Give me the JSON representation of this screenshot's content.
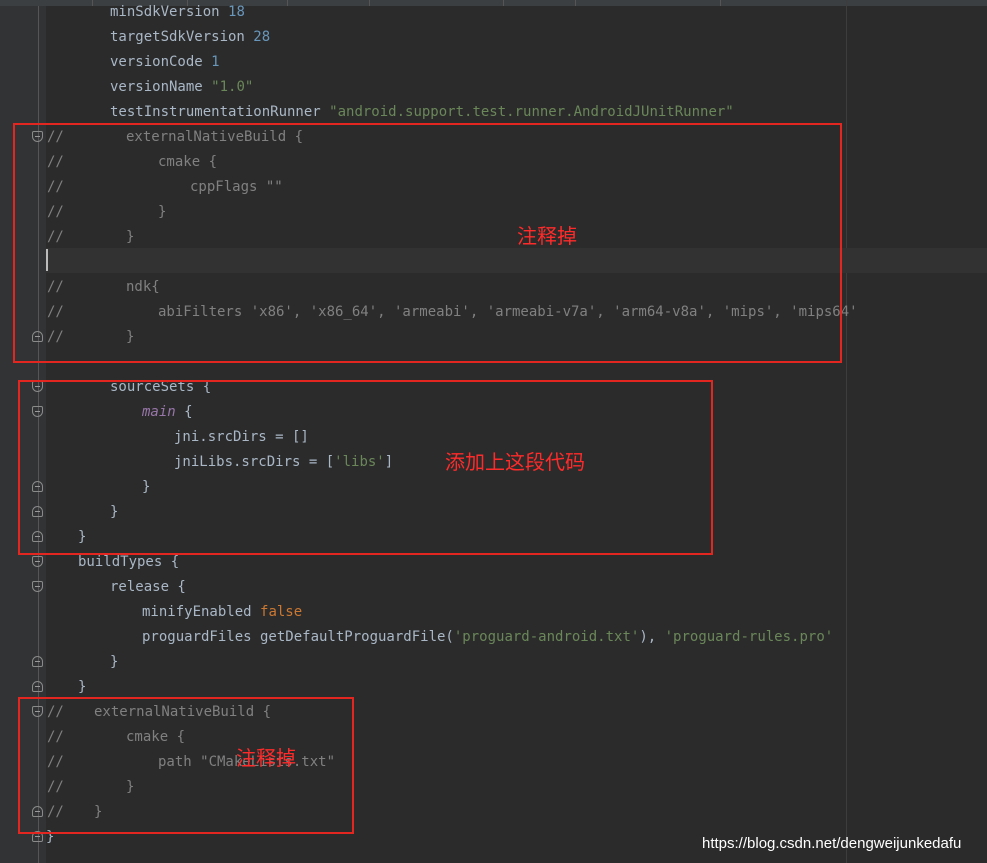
{
  "editor": {
    "lines": [
      {
        "id": "min-sdk",
        "segments": [
          {
            "t": "minSdkVersion ",
            "c": ""
          },
          {
            "t": "18",
            "c": "num"
          }
        ]
      },
      {
        "id": "target-sdk",
        "segments": [
          {
            "t": "targetSdkVersion ",
            "c": ""
          },
          {
            "t": "28",
            "c": "num"
          }
        ]
      },
      {
        "id": "version-code",
        "segments": [
          {
            "t": "versionCode ",
            "c": ""
          },
          {
            "t": "1",
            "c": "num"
          }
        ]
      },
      {
        "id": "version-name",
        "segments": [
          {
            "t": "versionName ",
            "c": ""
          },
          {
            "t": "\"1.0\"",
            "c": "str"
          }
        ]
      },
      {
        "id": "test-runner",
        "segments": [
          {
            "t": "testInstrumentationRunner ",
            "c": ""
          },
          {
            "t": "\"android.support.test.runner.AndroidJUnitRunner\"",
            "c": "str"
          }
        ]
      },
      {
        "id": "ext-native-build-1",
        "segments": [
          {
            "t": "externalNativeBuild {",
            "c": "cm"
          }
        ]
      },
      {
        "id": "cmake-1",
        "segments": [
          {
            "t": "cmake {",
            "c": "cm"
          }
        ]
      },
      {
        "id": "cpp-flags",
        "segments": [
          {
            "t": "cppFlags \"\"",
            "c": "cm"
          }
        ]
      },
      {
        "id": "close-1",
        "segments": [
          {
            "t": "}",
            "c": "cm"
          }
        ]
      },
      {
        "id": "close-2",
        "segments": [
          {
            "t": "}",
            "c": "cm"
          }
        ]
      },
      {
        "id": "blank",
        "segments": []
      },
      {
        "id": "ndk",
        "segments": [
          {
            "t": "ndk{",
            "c": "cm"
          }
        ]
      },
      {
        "id": "abi-filters",
        "segments": [
          {
            "t": "abiFilters 'x86', 'x86_64', 'armeabi', 'armeabi-v7a', 'arm64-v8a', 'mips', 'mips64'",
            "c": "cm"
          }
        ]
      },
      {
        "id": "close-3",
        "segments": [
          {
            "t": "}",
            "c": "cm"
          }
        ]
      },
      {
        "id": "empty",
        "segments": []
      },
      {
        "id": "source-sets",
        "segments": [
          {
            "t": "sourceSets {",
            "c": ""
          }
        ]
      },
      {
        "id": "main",
        "segments": [
          {
            "t": "main",
            "c": "ital"
          },
          {
            "t": " {",
            "c": ""
          }
        ]
      },
      {
        "id": "jni-src",
        "segments": [
          {
            "t": "jni.srcDirs = []",
            "c": ""
          }
        ]
      },
      {
        "id": "jni-libs",
        "segments": [
          {
            "t": "jniLibs.srcDirs = [",
            "c": ""
          },
          {
            "t": "'libs'",
            "c": "str"
          },
          {
            "t": "]",
            "c": ""
          }
        ]
      },
      {
        "id": "close-main",
        "segments": [
          {
            "t": "}",
            "c": ""
          }
        ]
      },
      {
        "id": "close-source-sets",
        "segments": [
          {
            "t": "}",
            "c": ""
          }
        ]
      },
      {
        "id": "close-default-config",
        "segments": [
          {
            "t": "}",
            "c": ""
          }
        ]
      },
      {
        "id": "build-types",
        "segments": [
          {
            "t": "buildTypes {",
            "c": ""
          }
        ]
      },
      {
        "id": "release",
        "segments": [
          {
            "t": "release {",
            "c": ""
          }
        ]
      },
      {
        "id": "minify",
        "segments": [
          {
            "t": "minifyEnabled ",
            "c": ""
          },
          {
            "t": "false",
            "c": "kw"
          }
        ]
      },
      {
        "id": "proguard",
        "segments": [
          {
            "t": "proguardFiles getDefaultProguardFile(",
            "c": ""
          },
          {
            "t": "'proguard-android.txt'",
            "c": "str"
          },
          {
            "t": "), ",
            "c": ""
          },
          {
            "t": "'proguard-rules.pro'",
            "c": "str"
          }
        ]
      },
      {
        "id": "close-release",
        "segments": [
          {
            "t": "}",
            "c": ""
          }
        ]
      },
      {
        "id": "close-build-types",
        "segments": [
          {
            "t": "}",
            "c": ""
          }
        ]
      },
      {
        "id": "ext-native-build-2",
        "segments": [
          {
            "t": "externalNativeBuild {",
            "c": "cm"
          }
        ]
      },
      {
        "id": "cmake-2",
        "segments": [
          {
            "t": "cmake {",
            "c": "cm"
          }
        ]
      },
      {
        "id": "cmake-path",
        "segments": [
          {
            "t": "path \"CMakeLists.txt\"",
            "c": "cm"
          }
        ]
      },
      {
        "id": "close-4",
        "segments": [
          {
            "t": "}",
            "c": "cm"
          }
        ]
      },
      {
        "id": "close-5",
        "segments": [
          {
            "t": "}",
            "c": "cm"
          }
        ]
      },
      {
        "id": "close-android",
        "segments": [
          {
            "t": "}",
            "c": ""
          }
        ]
      }
    ],
    "comment_marker": "//"
  },
  "annotations": {
    "comment_out_1": "注释掉",
    "add_code": "添加上这段代码",
    "comment_out_2": "注释掉"
  },
  "watermark": "https://blog.csdn.net/dengweijunkedafu",
  "colors": {
    "background": "#2b2b2b",
    "annotation_red": "#e3261f",
    "string": "#6a8759",
    "number": "#6897bb",
    "keyword": "#cc7832",
    "comment": "#808080"
  }
}
